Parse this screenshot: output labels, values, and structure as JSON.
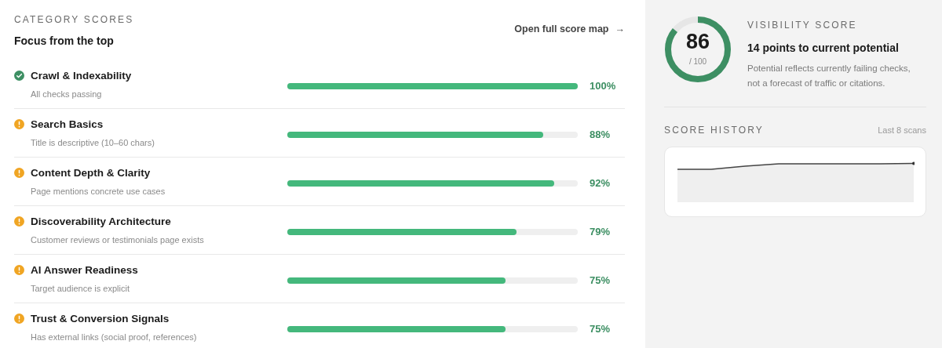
{
  "category_scores": {
    "eyebrow": "CATEGORY SCORES",
    "title": "Focus from the top",
    "link": {
      "label": "Open full score map",
      "arrow": "→"
    },
    "rows": [
      {
        "name": "Crawl & Indexability",
        "detail": "All checks passing",
        "kind": "pass",
        "level": 1.0,
        "percent": "100%"
      },
      {
        "name": "Search Basics",
        "detail": "Title is descriptive (10–60 chars)",
        "kind": "warn",
        "level": 0.88,
        "percent": "88%"
      },
      {
        "name": "Content Depth & Clarity",
        "detail": "Page mentions concrete use cases",
        "kind": "warn",
        "level": 0.92,
        "percent": "92%"
      },
      {
        "name": "Discoverability Architecture",
        "detail": "Customer reviews or testimonials page exists",
        "kind": "warn",
        "level": 0.79,
        "percent": "79%"
      },
      {
        "name": "AI Answer Readiness",
        "detail": "Target audience is explicit",
        "kind": "warn",
        "level": 0.75,
        "percent": "75%"
      },
      {
        "name": "Trust & Conversion Signals",
        "detail": "Has external links (social proof, references)",
        "kind": "warn",
        "level": 0.75,
        "percent": "75%"
      }
    ]
  },
  "visibility": {
    "score": "86",
    "out_of": "/ 100",
    "eyebrow": "VISIBILITY SCORE",
    "headline": "14 points to current potential",
    "note": "Potential reflects currently failing checks, not a forecast of traffic or citations."
  },
  "history": {
    "eyebrow": "SCORE HISTORY",
    "range": "Last 8 scans"
  }
}
